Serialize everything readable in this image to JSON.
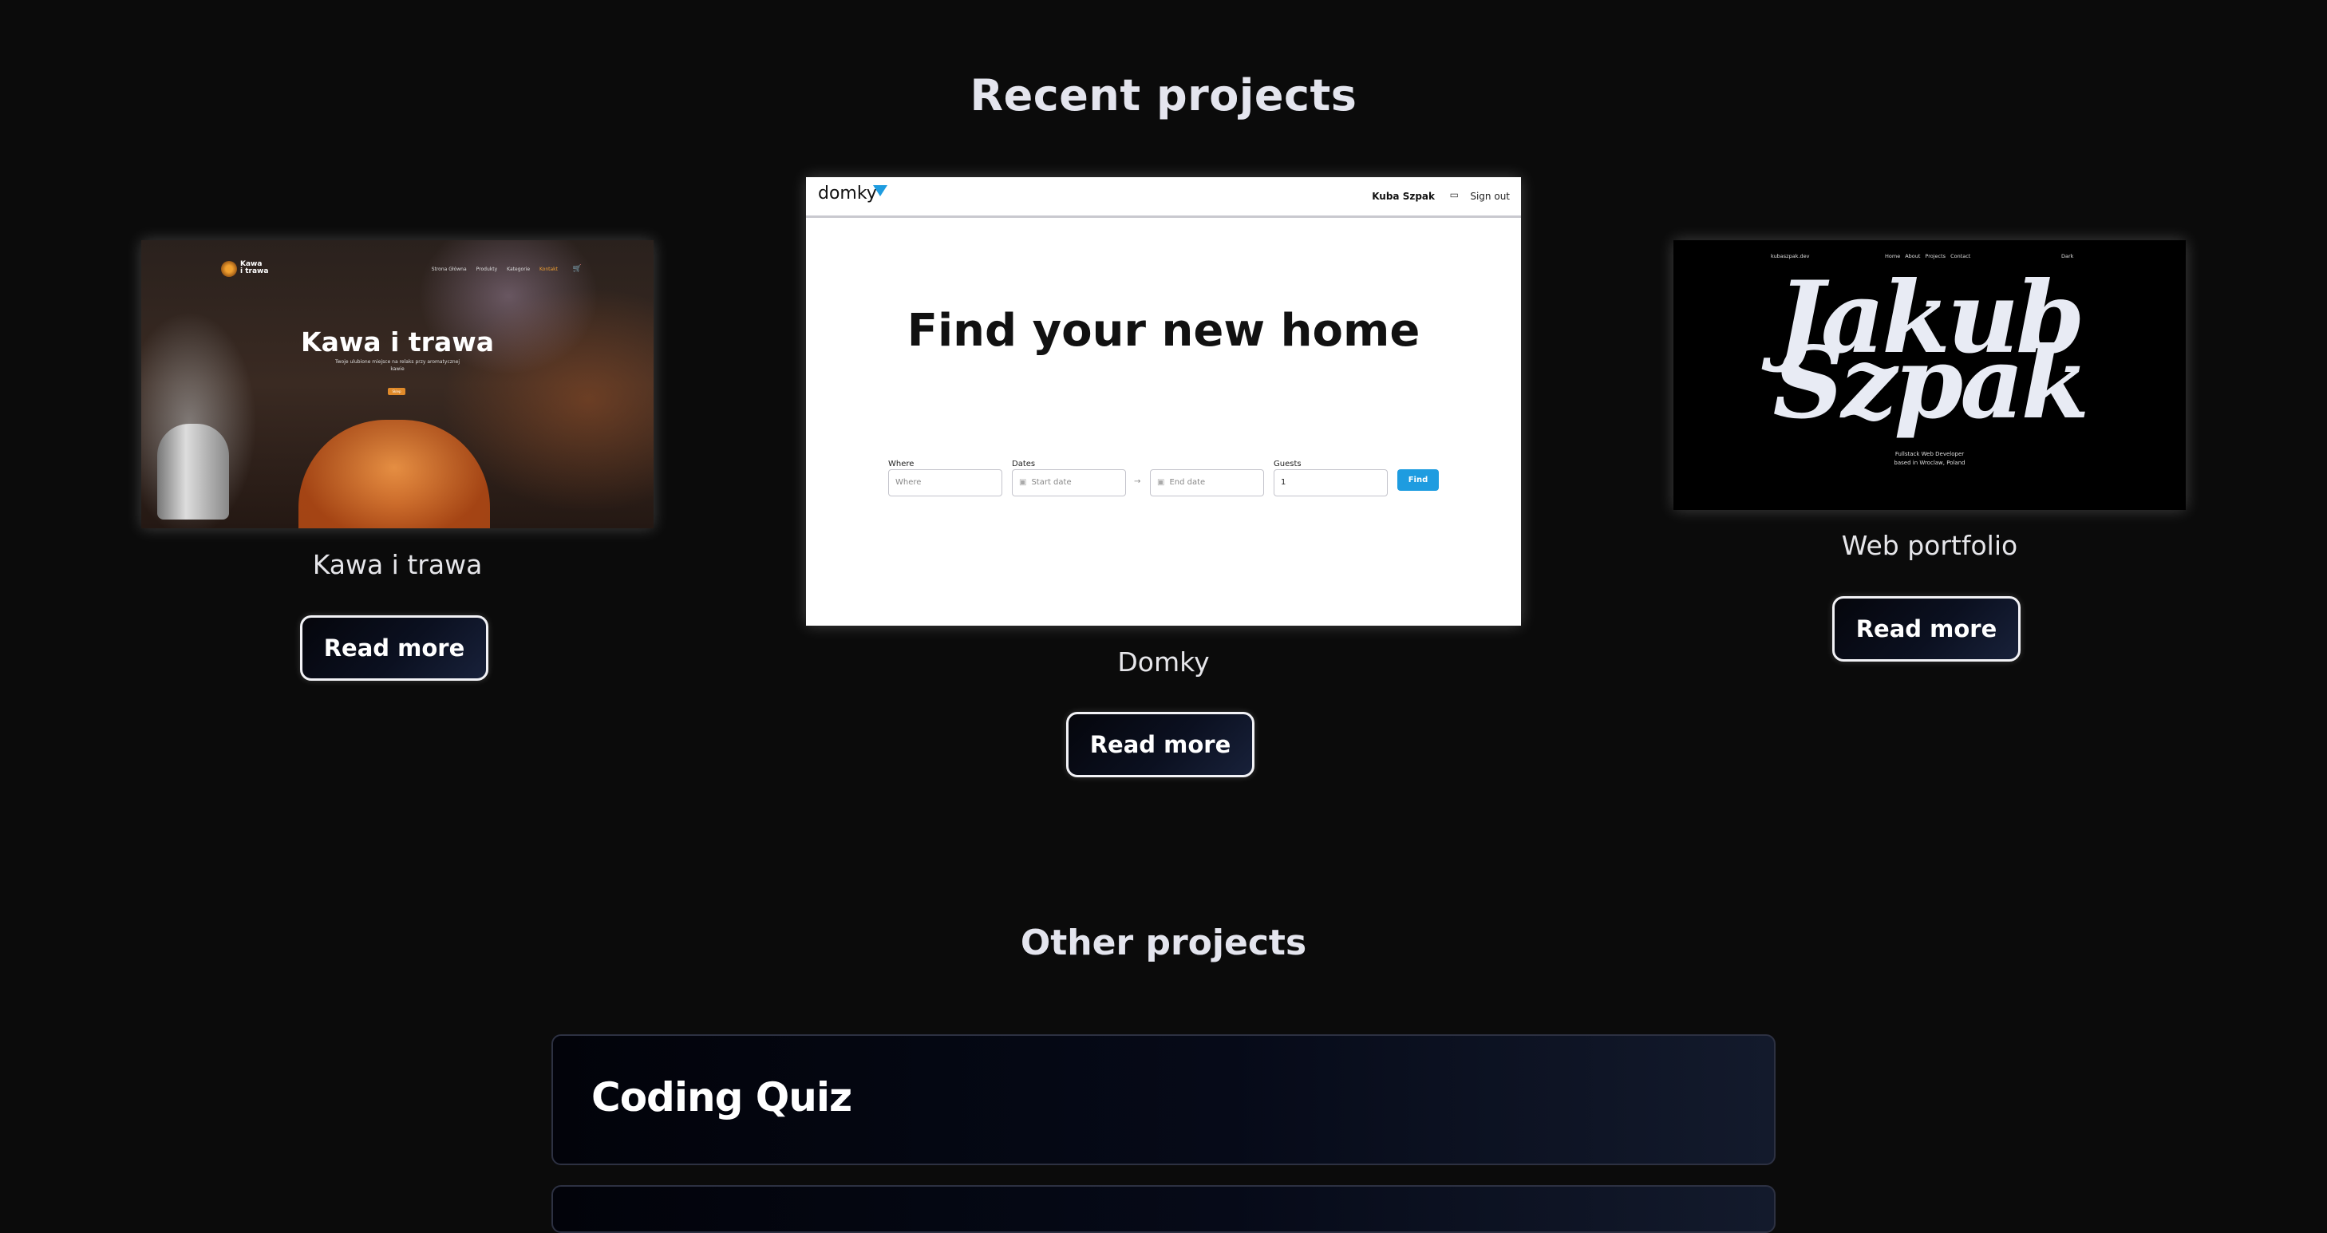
{
  "sections": {
    "recent_title": "Recent projects",
    "other_title": "Other projects"
  },
  "projects": [
    {
      "name": "Kawa i trawa",
      "read_more": "Read more",
      "thumbnail": {
        "logo_text_1": "Kawa",
        "logo_text_2": "i trawa",
        "nav": [
          "Strona Główna",
          "Produkty",
          "Kategorie",
          "Kontakt"
        ],
        "hero_title": "Kawa i trawa",
        "hero_sub": "Twoje ulubione miejsce na relaks przy aromatycznej kawie",
        "hero_button": "Sklep"
      }
    },
    {
      "name": "Domky",
      "read_more": "Read more",
      "thumbnail": {
        "brand": "domky",
        "user": "Kuba Szpak",
        "sign_out": "Sign out",
        "headline": "Find your new home",
        "where_label": "Where",
        "where_placeholder": "Where",
        "dates_label": "Dates",
        "start_placeholder": "Start date",
        "end_placeholder": "End date",
        "guests_label": "Guests",
        "guests_value": "1",
        "find_label": "Find",
        "accent": "#1e9ce0"
      }
    },
    {
      "name": "Web portfolio",
      "read_more": "Read more",
      "thumbnail": {
        "site": "kubaszpak.dev",
        "nav": [
          "Home",
          "About",
          "Projects",
          "Contact"
        ],
        "mode": "Dark",
        "big_line_1": "Jakub",
        "big_line_2": "Szpak",
        "tagline_1": "Fullstack Web Developer",
        "tagline_2": "based in Wroclaw, Poland"
      }
    }
  ],
  "other_projects": [
    {
      "title": "Coding Quiz"
    }
  ]
}
